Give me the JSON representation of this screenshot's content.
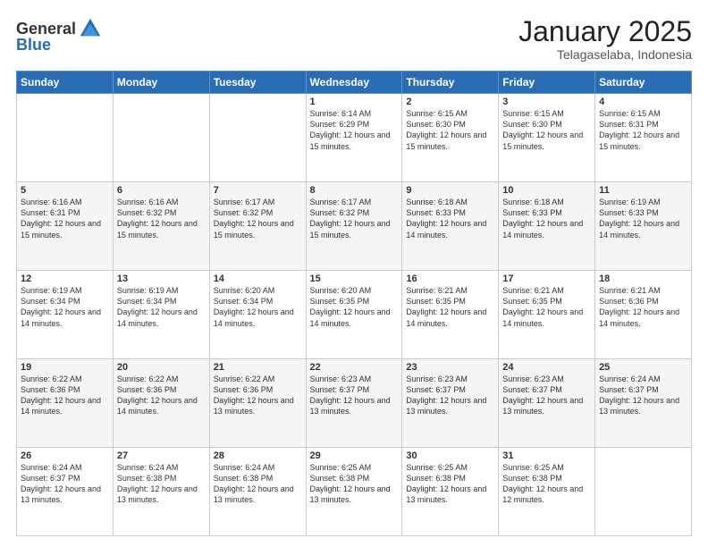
{
  "header": {
    "logo_general": "General",
    "logo_blue": "Blue",
    "month": "January 2025",
    "location": "Telagaselaba, Indonesia"
  },
  "weekdays": [
    "Sunday",
    "Monday",
    "Tuesday",
    "Wednesday",
    "Thursday",
    "Friday",
    "Saturday"
  ],
  "weeks": [
    [
      {
        "day": "",
        "info": ""
      },
      {
        "day": "",
        "info": ""
      },
      {
        "day": "",
        "info": ""
      },
      {
        "day": "1",
        "info": "Sunrise: 6:14 AM\nSunset: 6:29 PM\nDaylight: 12 hours\nand 15 minutes."
      },
      {
        "day": "2",
        "info": "Sunrise: 6:15 AM\nSunset: 6:30 PM\nDaylight: 12 hours\nand 15 minutes."
      },
      {
        "day": "3",
        "info": "Sunrise: 6:15 AM\nSunset: 6:30 PM\nDaylight: 12 hours\nand 15 minutes."
      },
      {
        "day": "4",
        "info": "Sunrise: 6:15 AM\nSunset: 6:31 PM\nDaylight: 12 hours\nand 15 minutes."
      }
    ],
    [
      {
        "day": "5",
        "info": "Sunrise: 6:16 AM\nSunset: 6:31 PM\nDaylight: 12 hours\nand 15 minutes."
      },
      {
        "day": "6",
        "info": "Sunrise: 6:16 AM\nSunset: 6:32 PM\nDaylight: 12 hours\nand 15 minutes."
      },
      {
        "day": "7",
        "info": "Sunrise: 6:17 AM\nSunset: 6:32 PM\nDaylight: 12 hours\nand 15 minutes."
      },
      {
        "day": "8",
        "info": "Sunrise: 6:17 AM\nSunset: 6:32 PM\nDaylight: 12 hours\nand 15 minutes."
      },
      {
        "day": "9",
        "info": "Sunrise: 6:18 AM\nSunset: 6:33 PM\nDaylight: 12 hours\nand 14 minutes."
      },
      {
        "day": "10",
        "info": "Sunrise: 6:18 AM\nSunset: 6:33 PM\nDaylight: 12 hours\nand 14 minutes."
      },
      {
        "day": "11",
        "info": "Sunrise: 6:19 AM\nSunset: 6:33 PM\nDaylight: 12 hours\nand 14 minutes."
      }
    ],
    [
      {
        "day": "12",
        "info": "Sunrise: 6:19 AM\nSunset: 6:34 PM\nDaylight: 12 hours\nand 14 minutes."
      },
      {
        "day": "13",
        "info": "Sunrise: 6:19 AM\nSunset: 6:34 PM\nDaylight: 12 hours\nand 14 minutes."
      },
      {
        "day": "14",
        "info": "Sunrise: 6:20 AM\nSunset: 6:34 PM\nDaylight: 12 hours\nand 14 minutes."
      },
      {
        "day": "15",
        "info": "Sunrise: 6:20 AM\nSunset: 6:35 PM\nDaylight: 12 hours\nand 14 minutes."
      },
      {
        "day": "16",
        "info": "Sunrise: 6:21 AM\nSunset: 6:35 PM\nDaylight: 12 hours\nand 14 minutes."
      },
      {
        "day": "17",
        "info": "Sunrise: 6:21 AM\nSunset: 6:35 PM\nDaylight: 12 hours\nand 14 minutes."
      },
      {
        "day": "18",
        "info": "Sunrise: 6:21 AM\nSunset: 6:36 PM\nDaylight: 12 hours\nand 14 minutes."
      }
    ],
    [
      {
        "day": "19",
        "info": "Sunrise: 6:22 AM\nSunset: 6:36 PM\nDaylight: 12 hours\nand 14 minutes."
      },
      {
        "day": "20",
        "info": "Sunrise: 6:22 AM\nSunset: 6:36 PM\nDaylight: 12 hours\nand 14 minutes."
      },
      {
        "day": "21",
        "info": "Sunrise: 6:22 AM\nSunset: 6:36 PM\nDaylight: 12 hours\nand 13 minutes."
      },
      {
        "day": "22",
        "info": "Sunrise: 6:23 AM\nSunset: 6:37 PM\nDaylight: 12 hours\nand 13 minutes."
      },
      {
        "day": "23",
        "info": "Sunrise: 6:23 AM\nSunset: 6:37 PM\nDaylight: 12 hours\nand 13 minutes."
      },
      {
        "day": "24",
        "info": "Sunrise: 6:23 AM\nSunset: 6:37 PM\nDaylight: 12 hours\nand 13 minutes."
      },
      {
        "day": "25",
        "info": "Sunrise: 6:24 AM\nSunset: 6:37 PM\nDaylight: 12 hours\nand 13 minutes."
      }
    ],
    [
      {
        "day": "26",
        "info": "Sunrise: 6:24 AM\nSunset: 6:37 PM\nDaylight: 12 hours\nand 13 minutes."
      },
      {
        "day": "27",
        "info": "Sunrise: 6:24 AM\nSunset: 6:38 PM\nDaylight: 12 hours\nand 13 minutes."
      },
      {
        "day": "28",
        "info": "Sunrise: 6:24 AM\nSunset: 6:38 PM\nDaylight: 12 hours\nand 13 minutes."
      },
      {
        "day": "29",
        "info": "Sunrise: 6:25 AM\nSunset: 6:38 PM\nDaylight: 12 hours\nand 13 minutes."
      },
      {
        "day": "30",
        "info": "Sunrise: 6:25 AM\nSunset: 6:38 PM\nDaylight: 12 hours\nand 13 minutes."
      },
      {
        "day": "31",
        "info": "Sunrise: 6:25 AM\nSunset: 6:38 PM\nDaylight: 12 hours\nand 12 minutes."
      },
      {
        "day": "",
        "info": ""
      }
    ]
  ]
}
